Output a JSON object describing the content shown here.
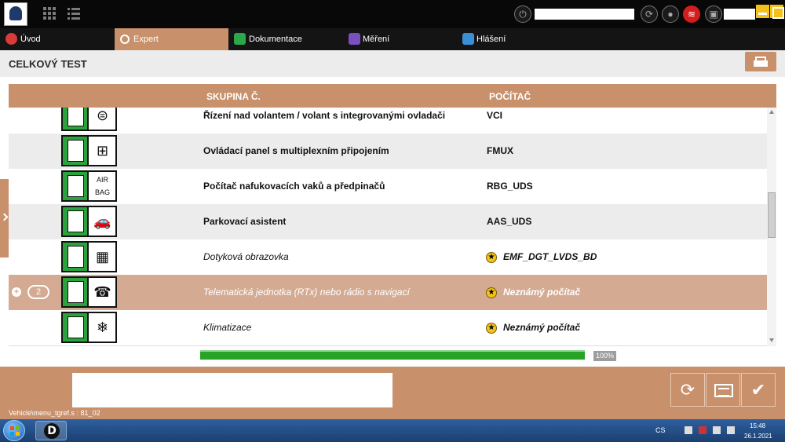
{
  "tabs": [
    {
      "label": "Úvod",
      "icon": "home-icon",
      "color": "#d93a3a"
    },
    {
      "label": "Expert",
      "icon": "gears-icon",
      "color": "#ffffff"
    },
    {
      "label": "Dokumentace",
      "icon": "folder-icon",
      "color": "#2ba84a"
    },
    {
      "label": "Měření",
      "icon": "waveform-icon",
      "color": "#7a4fc0"
    },
    {
      "label": "Hlášení",
      "icon": "report-icon",
      "color": "#3a8fd9"
    }
  ],
  "active_tab": "Expert",
  "page": {
    "title": "CELKOVÝ TEST"
  },
  "table": {
    "headers": {
      "group": "SKUPINA Č.",
      "computer": "POČÍTAČ"
    },
    "rows": [
      {
        "group": "Řízení nad volantem / volant s integrovanými ovladači",
        "computer": "VCI",
        "icon": "steering-wheel-icon",
        "symbol": "⊜",
        "star": false,
        "italic": false
      },
      {
        "group": "Ovládací panel s multiplexním připojením",
        "computer": "FMUX",
        "icon": "multiplex-panel-icon",
        "symbol": "⊞",
        "star": false,
        "italic": false
      },
      {
        "group": "Počítač nafukovacích vaků a předpinačů",
        "computer": "RBG_UDS",
        "icon": "airbag-icon",
        "symbol": "AIR BAG",
        "star": false,
        "italic": false
      },
      {
        "group": "Parkovací asistent",
        "computer": "AAS_UDS",
        "icon": "parking-car-icon",
        "symbol": "🚗",
        "star": false,
        "italic": false
      },
      {
        "group": "Dotyková obrazovka",
        "computer": "EMF_DGT_LVDS_BD",
        "icon": "touchscreen-icon",
        "symbol": "▦",
        "star": true,
        "italic": true
      },
      {
        "group": "Telematická jednotka (RTx) nebo rádio s navigací",
        "computer": "Neznámý počítač",
        "icon": "telephone-icon",
        "symbol": "☎",
        "star": true,
        "italic": true,
        "selected": true,
        "expand_count": "2"
      },
      {
        "group": "Klimatizace",
        "computer": "Neznámý počítač",
        "icon": "climate-icon",
        "symbol": "❄",
        "star": true,
        "italic": true
      }
    ]
  },
  "progress": {
    "value": 100,
    "label": "100%"
  },
  "status_text": "Vehicle\\menu_tgref.s : 81_02",
  "taskbar": {
    "language": "CS",
    "time": "15:48",
    "date": "26.1.2021",
    "app_letter": "D"
  },
  "colors": {
    "accent": "#c8906b",
    "selected_row": "#d4ab92",
    "progress": "#27a327"
  }
}
